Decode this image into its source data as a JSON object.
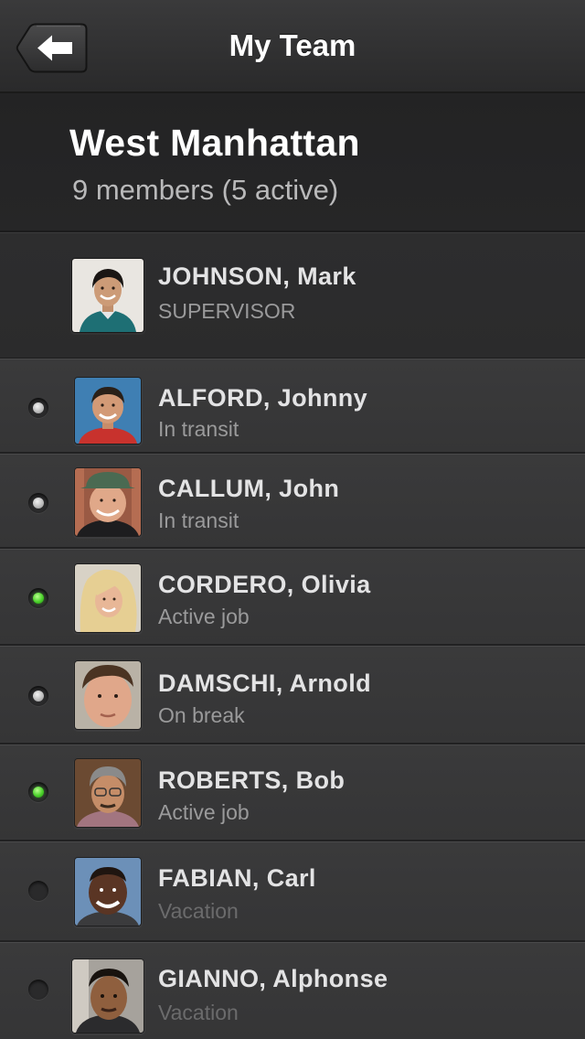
{
  "nav": {
    "title": "My Team",
    "back_icon": "back-arrow-icon"
  },
  "team": {
    "name": "West Manhattan",
    "summary": "9 members (5 active)"
  },
  "supervisor": {
    "name": "JOHNSON, Mark",
    "role": "SUPERVISOR"
  },
  "status_colors": {
    "active": "#4ad12a",
    "inactive": "#bdbdbd",
    "off": "#2a2a2b"
  },
  "members": [
    {
      "name": "ALFORD, Johnny",
      "status": "In transit",
      "indicator": "gray"
    },
    {
      "name": "CALLUM, John",
      "status": "In transit",
      "indicator": "gray"
    },
    {
      "name": "CORDERO, Olivia",
      "status": "Active job",
      "indicator": "green"
    },
    {
      "name": "DAMSCHI, Arnold",
      "status": "On break",
      "indicator": "gray"
    },
    {
      "name": "ROBERTS, Bob",
      "status": "Active job",
      "indicator": "green"
    },
    {
      "name": "FABIAN, Carl",
      "status": "Vacation",
      "indicator": "off"
    },
    {
      "name": "GIANNO, Alphonse",
      "status": "Vacation",
      "indicator": "off"
    }
  ]
}
